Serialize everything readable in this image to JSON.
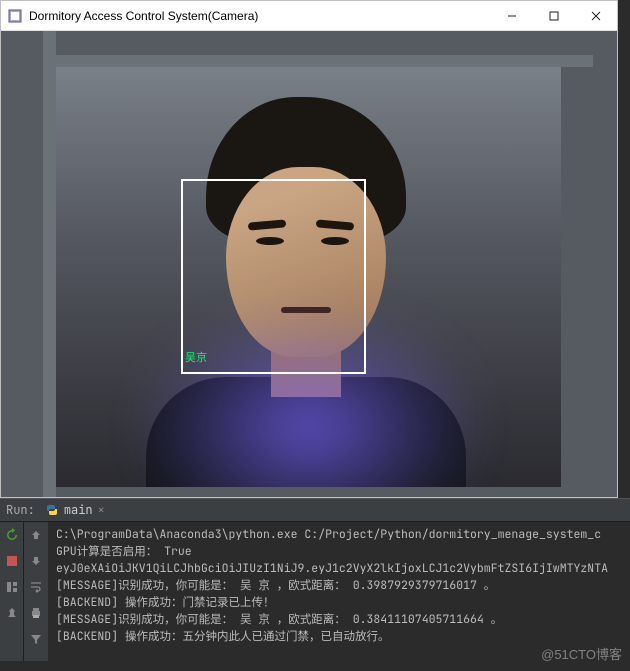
{
  "window": {
    "title": "Dormitory Access Control System(Camera)",
    "minimize": "—",
    "maximize": "☐",
    "close": "✕"
  },
  "face": {
    "label": "吴京"
  },
  "ide": {
    "run_label": "Run:",
    "tab_name": "main",
    "tab_close": "×"
  },
  "console": {
    "lines": [
      "C:\\ProgramData\\Anaconda3\\python.exe C:/Project/Python/dormitory_menage_system_c",
      "GPU计算是否启用：  True",
      "eyJ0eXAiOiJKV1QiLCJhbGciOiJIUzI1NiJ9.eyJ1c2VyX2lkIjoxLCJ1c2VybmFtZSI6IjIwMTYzNTA",
      "[MESSAGE]识别成功，你可能是： 吴 京 ，欧式距离： 0.3987929379716017 。",
      "[BACKEND] 操作成功：门禁记录已上传！",
      "[MESSAGE]识别成功，你可能是： 吴 京 ，欧式距离： 0.38411107405711664 。",
      "[BACKEND] 操作成功：五分钟内此人已通过门禁，已自动放行。"
    ]
  },
  "watermark": "@51CTO博客"
}
